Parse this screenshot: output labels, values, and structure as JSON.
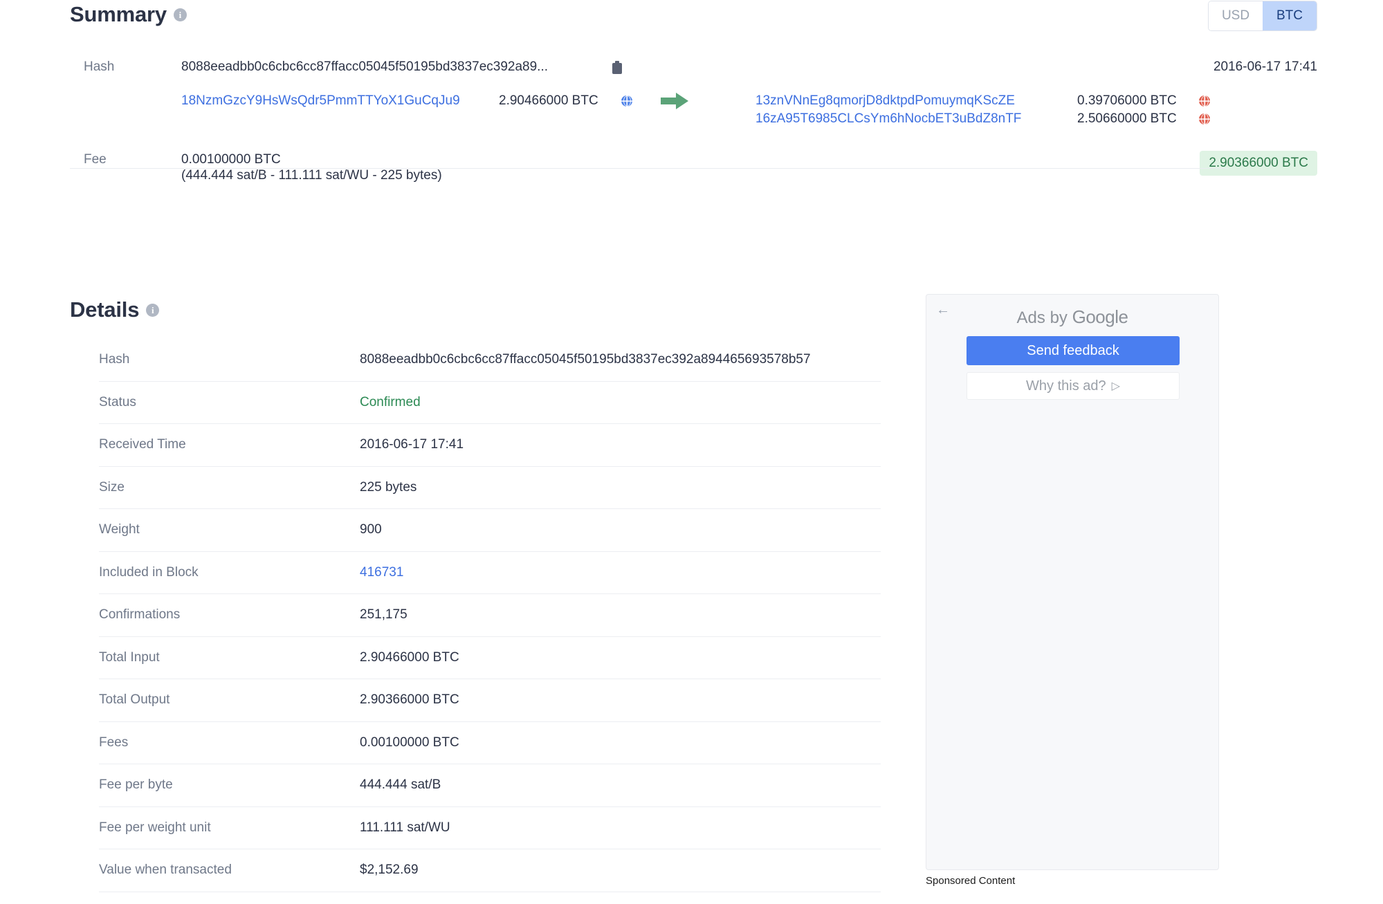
{
  "summary": {
    "title": "Summary",
    "info_icon": "info-icon",
    "currency_toggle": {
      "usd": "USD",
      "btc": "BTC",
      "active": "BTC"
    },
    "hash_label": "Hash",
    "hash_truncated": "8088eeadbb0c6cbc6cc87ffacc05045f50195bd3837ec392a89...",
    "copy_icon": "clipboard-icon",
    "timestamp": "2016-06-17 17:41",
    "inputs": [
      {
        "address": "18NzmGzcY9HsWsQdr5PmmTTYoX1GuCqJu9",
        "amount": "2.90466000 BTC",
        "globe": "globe-icon-blue"
      }
    ],
    "arrow_icon": "arrow-right-icon",
    "outputs": [
      {
        "address": "13znVNnEg8qmorjD8dktpdPomuymqKScZE",
        "amount": "0.39706000 BTC",
        "globe": "globe-icon-red"
      },
      {
        "address": "16zA95T6985CLCsYm6hNocbET3uBdZ8nTF",
        "amount": "2.50660000 BTC",
        "globe": "globe-icon-red"
      }
    ],
    "fee_label": "Fee",
    "fee_amount": "0.00100000 BTC",
    "fee_detail": "(444.444 sat/B - 111.111 sat/WU - 225 bytes)",
    "total_badge": "2.90366000 BTC",
    "badge_color": "#dff3e4",
    "badge_text_color": "#2c7a4b"
  },
  "details": {
    "title": "Details",
    "info_icon": "info-icon",
    "rows": [
      {
        "label": "Hash",
        "value": "8088eeadbb0c6cbc6cc87ffacc05045f50195bd3837ec392a894465693578b57",
        "style": "plain"
      },
      {
        "label": "Status",
        "value": "Confirmed",
        "style": "green"
      },
      {
        "label": "Received Time",
        "value": "2016-06-17 17:41",
        "style": "plain"
      },
      {
        "label": "Size",
        "value": "225 bytes",
        "style": "plain"
      },
      {
        "label": "Weight",
        "value": "900",
        "style": "plain"
      },
      {
        "label": "Included in Block",
        "value": "416731",
        "style": "link"
      },
      {
        "label": "Confirmations",
        "value": "251,175",
        "style": "plain"
      },
      {
        "label": "Total Input",
        "value": "2.90466000 BTC",
        "style": "plain"
      },
      {
        "label": "Total Output",
        "value": "2.90366000 BTC",
        "style": "plain"
      },
      {
        "label": "Fees",
        "value": "0.00100000 BTC",
        "style": "plain"
      },
      {
        "label": "Fee per byte",
        "value": "444.444 sat/B",
        "style": "plain"
      },
      {
        "label": "Fee per weight unit",
        "value": "111.111 sat/WU",
        "style": "plain"
      },
      {
        "label": "Value when transacted",
        "value": "$2,152.69",
        "style": "plain"
      }
    ]
  },
  "ad_panel": {
    "back_icon": "back-arrow-icon",
    "title_prefix": "Ads by ",
    "title_brand": "Google",
    "send_feedback": "Send feedback",
    "why_this_ad": "Why this ad?",
    "why_icon": "play-triangle-icon",
    "sponsored_label": "Sponsored Content"
  }
}
